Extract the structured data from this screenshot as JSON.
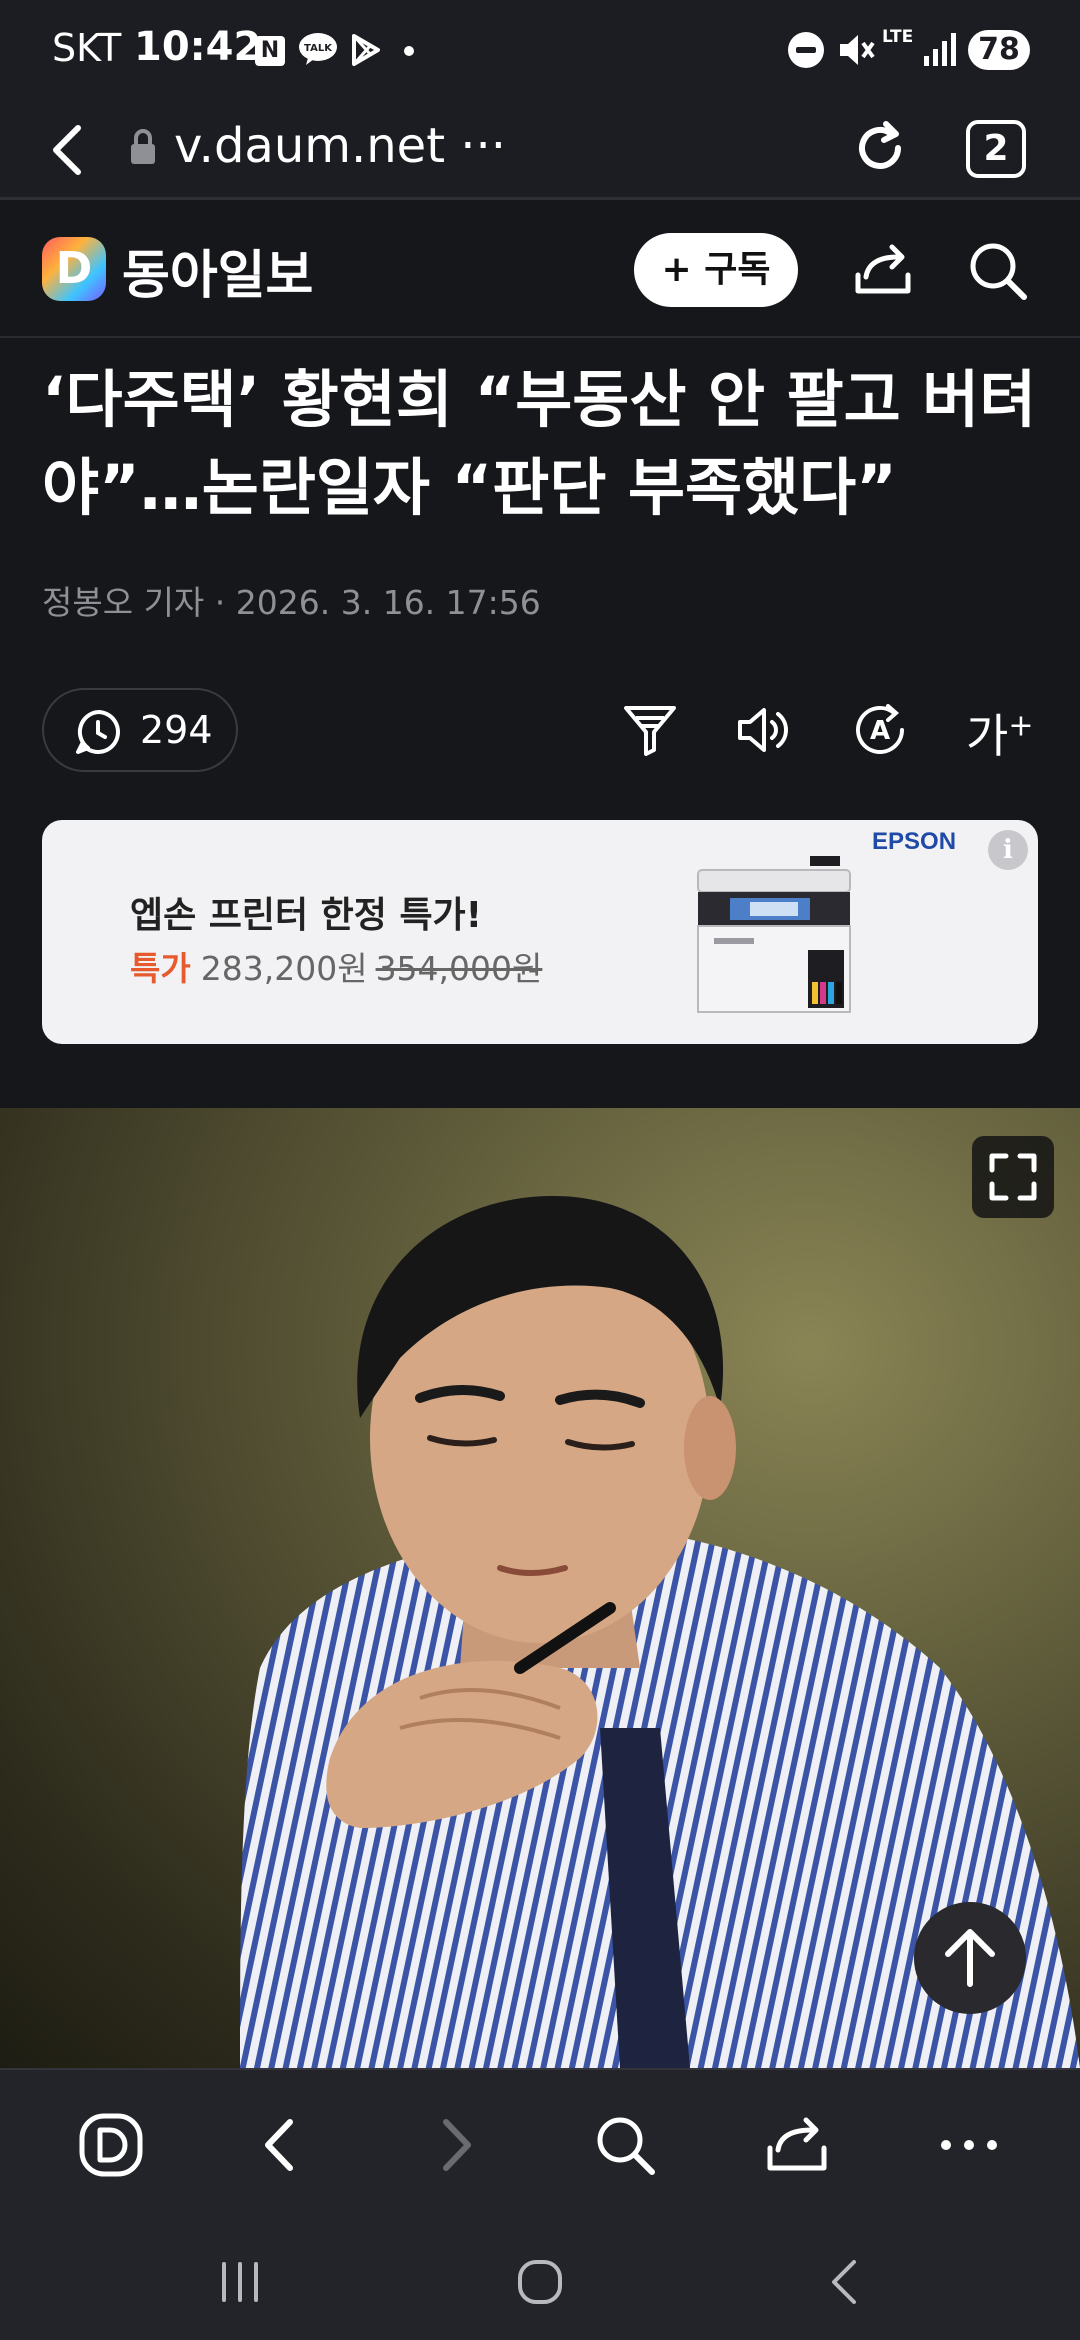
{
  "status_bar": {
    "carrier": "SKT",
    "time": "10:42",
    "notif_n": "N",
    "talk": "TALK",
    "lte": "LTE",
    "battery": "78"
  },
  "url_bar": {
    "url": "v.daum.net ···",
    "tab_count": "2"
  },
  "site_header": {
    "logo_letter": "D",
    "brand": "동아일보",
    "subscribe_label": "+ 구독"
  },
  "article": {
    "title": "‘다주택’ 황현희 “부동산 안 팔고 버텨야”…논란일자 “판단 부족했다”",
    "byline": "정봉오 기자 ·  2026. 3. 16. 17:56",
    "comment_count": "294",
    "font_size_label": "가",
    "font_size_plus": "+"
  },
  "ad": {
    "brand": "EPSON",
    "headline": "엡손 프린터 한정 특가!",
    "sale_label": "특가",
    "price": "283,200원",
    "original_price": "354,000원",
    "info": "i"
  },
  "icons": {
    "status": [
      "n-icon",
      "talk-icon",
      "play-store-icon",
      "do-not-disturb-icon",
      "mute-icon",
      "signal-icon"
    ],
    "toolbar": [
      "filter-icon",
      "speaker-icon",
      "translate-icon",
      "font-size-icon"
    ],
    "bottom": [
      "daum-home-icon",
      "back-icon",
      "forward-icon",
      "search-icon",
      "share-icon",
      "more-icon"
    ],
    "nav": [
      "recents-icon",
      "home-icon",
      "back-icon"
    ]
  }
}
